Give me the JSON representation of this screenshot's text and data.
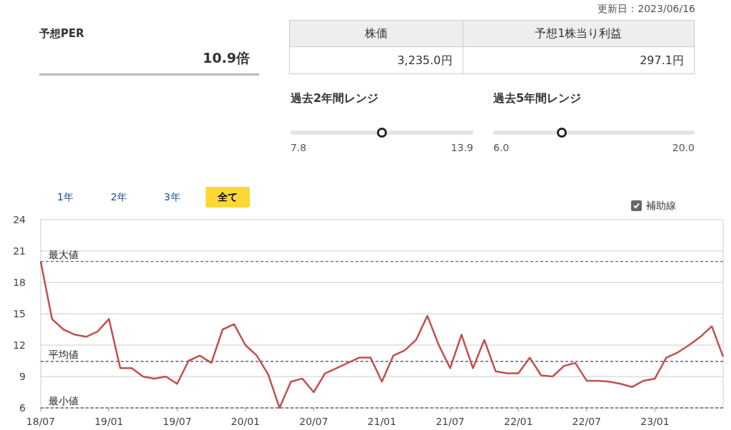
{
  "updated": "更新日：2023/06/16",
  "per": {
    "label": "予想PER",
    "value": "10.9倍"
  },
  "table": {
    "columns": [
      "株価",
      "予想1株当り利益"
    ],
    "values": [
      "3,235.0円",
      "297.1円"
    ]
  },
  "ranges": [
    {
      "title": "過去2年間レンジ",
      "min": "7.8",
      "max": "13.9",
      "level": 0.5
    },
    {
      "title": "過去5年間レンジ",
      "min": "6.0",
      "max": "20.0",
      "level": 0.34
    }
  ],
  "period_tabs": [
    {
      "label": "1年",
      "selected": false
    },
    {
      "label": "2年",
      "selected": false
    },
    {
      "label": "3年",
      "selected": false
    },
    {
      "label": "全て",
      "selected": true
    }
  ],
  "guide_lines": {
    "label": "補助線",
    "checked": true
  },
  "chart_data": {
    "type": "line",
    "ylim": [
      6,
      24
    ],
    "yticks": [
      6,
      9,
      12,
      15,
      18,
      21,
      24
    ],
    "categories": [
      "18/07",
      null,
      null,
      null,
      null,
      null,
      "19/01",
      null,
      null,
      null,
      null,
      null,
      "19/07",
      null,
      null,
      null,
      null,
      null,
      "20/01",
      null,
      null,
      null,
      null,
      null,
      "20/07",
      null,
      null,
      null,
      null,
      null,
      "21/01",
      null,
      null,
      null,
      null,
      null,
      "21/07",
      null,
      null,
      null,
      null,
      null,
      "22/01",
      null,
      null,
      null,
      null,
      null,
      "22/07",
      null,
      null,
      null,
      null,
      null,
      "23/01",
      null,
      null,
      null,
      null,
      null,
      null
    ],
    "series": [
      {
        "color": "#c0504d",
        "values": [
          20,
          14.5,
          13.5,
          13.0,
          12.8,
          13.3,
          14.5,
          9.8,
          9.8,
          9.0,
          8.8,
          9.0,
          8.3,
          10.5,
          11.0,
          10.3,
          13.5,
          14.0,
          12.0,
          11.0,
          9.2,
          6.0,
          8.5,
          8.8,
          7.5,
          9.3,
          9.8,
          10.3,
          10.8,
          10.8,
          8.5,
          11.0,
          11.5,
          12.5,
          14.8,
          12.0,
          9.8,
          13.0,
          9.8,
          12.5,
          9.5,
          9.3,
          9.3,
          10.8,
          9.1,
          9.0,
          10.0,
          10.3,
          8.6,
          8.6,
          8.5,
          8.3,
          8.0,
          8.6,
          8.8,
          10.8,
          11.3,
          12.0,
          12.8,
          13.8,
          10.9
        ]
      }
    ],
    "grid": true,
    "ref_lines": [
      {
        "axis": "y",
        "value": 20,
        "label": "最大値"
      },
      {
        "axis": "y",
        "value": 10.45,
        "label": "平均値"
      },
      {
        "axis": "y",
        "value": 6,
        "label": "最小値"
      }
    ]
  }
}
